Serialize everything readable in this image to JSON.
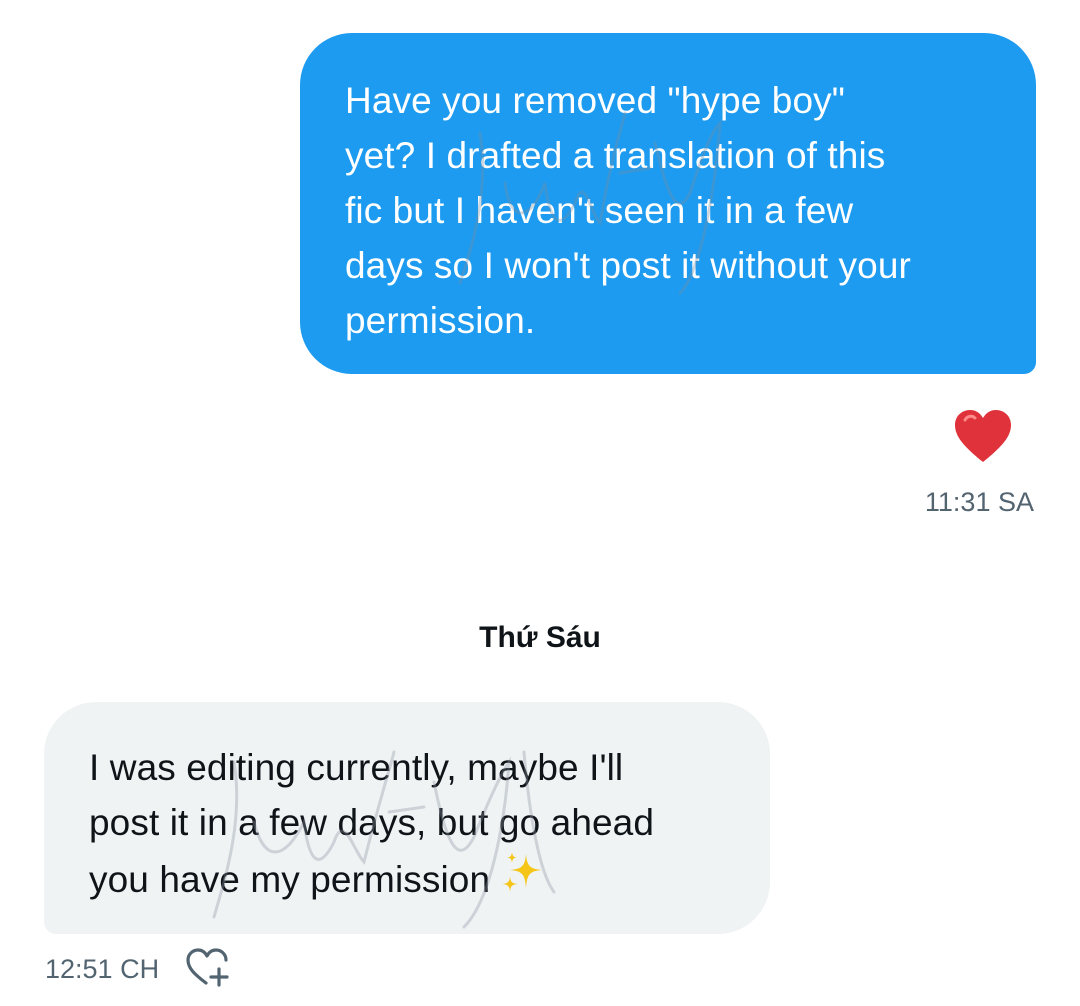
{
  "conversation": {
    "sent_message": {
      "lines": [
        "Have you removed \"hype boy\"",
        "yet? I drafted a translation of this",
        "fic but I haven't seen it in a few",
        "days so I won't post it without your",
        "permission."
      ],
      "reaction": "red-heart",
      "time": "11:31 SA"
    },
    "day_divider": "Thứ Sáu",
    "received_message": {
      "lines": [
        "I was editing currently, maybe I'll",
        "post it in a few days, but go ahead",
        "you have my permission"
      ],
      "trailing_emoji": "sparkles",
      "time": "12:51 CH"
    },
    "watermark_text": "justfyh"
  },
  "colors": {
    "sent_bubble": "#1d9bf0",
    "received_bubble": "#eff3f4",
    "timestamp": "#536471",
    "heart": "#e0323a",
    "sparkle": "#f5c518"
  },
  "icons": {
    "reaction": "heart-icon",
    "add_reaction": "add-reaction-icon",
    "trailing": "sparkles-icon"
  }
}
